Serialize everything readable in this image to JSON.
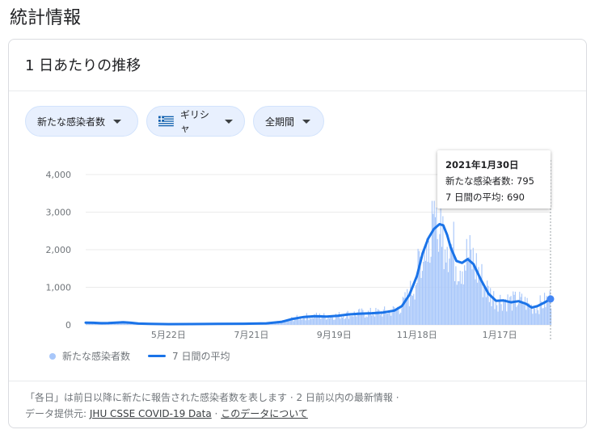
{
  "page_title": "統計情報",
  "card": {
    "title": "1 日あたりの推移",
    "filters": {
      "metric": "新たな感染者数",
      "country": "ギリシャ",
      "period": "全期間"
    }
  },
  "tooltip": {
    "date": "2021年1月30日",
    "cases_label": "新たな感染者数: 795",
    "avg_label": "7 日間の平均: 690"
  },
  "legend": {
    "bars": "新たな感染者数",
    "line": "7 日間の平均"
  },
  "footer": {
    "note": "「各日」は前日以降に新たに報告された感染者数を表します · 2 日前以内の最新情報 ·",
    "source_prefix": "データ提供元:",
    "source_link": "JHU CSSE COVID-19 Data",
    "separator": "·",
    "about_link": "このデータについて"
  },
  "colors": {
    "bars": "#a8c7fa",
    "line": "#1a73e8",
    "chip_bg": "#e8f0fe"
  },
  "chart_data": {
    "type": "bar",
    "title": "1 日あたりの推移",
    "series": [
      {
        "name": "新たな感染者数",
        "type": "bar"
      },
      {
        "name": "7 日間の平均",
        "type": "line"
      }
    ],
    "y_ticks": [
      "4,000",
      "3,000",
      "2,000",
      "1,000",
      "0"
    ],
    "ylim": [
      0,
      4000
    ],
    "x_ticks": [
      "5月22日",
      "7月21日",
      "9月19日",
      "11月18日",
      "1月17日"
    ],
    "grid": true,
    "legend_position": "bottom-left",
    "seven_day_avg": [
      [
        0,
        60
      ],
      [
        2,
        55
      ],
      [
        4,
        45
      ],
      [
        6,
        50
      ],
      [
        8,
        60
      ],
      [
        10,
        70
      ],
      [
        12,
        55
      ],
      [
        14,
        35
      ],
      [
        17,
        25
      ],
      [
        22,
        20
      ],
      [
        28,
        22
      ],
      [
        35,
        25
      ],
      [
        42,
        30
      ],
      [
        48,
        40
      ],
      [
        52,
        80
      ],
      [
        55,
        160
      ],
      [
        58,
        210
      ],
      [
        61,
        230
      ],
      [
        64,
        220
      ],
      [
        67,
        240
      ],
      [
        70,
        280
      ],
      [
        73,
        300
      ],
      [
        76,
        310
      ],
      [
        79,
        330
      ],
      [
        82,
        380
      ],
      [
        84,
        500
      ],
      [
        86,
        800
      ],
      [
        88,
        1300
      ],
      [
        89.5,
        1900
      ],
      [
        91,
        2300
      ],
      [
        92.5,
        2550
      ],
      [
        94,
        2680
      ],
      [
        95,
        2650
      ],
      [
        96,
        2400
      ],
      [
        97,
        2050
      ],
      [
        98.5,
        1700
      ],
      [
        100,
        1650
      ],
      [
        101.5,
        1750
      ],
      [
        103,
        1620
      ],
      [
        105,
        1200
      ],
      [
        107,
        830
      ],
      [
        109,
        640
      ],
      [
        111,
        650
      ],
      [
        113,
        600
      ],
      [
        115,
        630
      ],
      [
        117,
        560
      ],
      [
        118.5,
        460
      ],
      [
        120,
        500
      ],
      [
        122,
        600
      ],
      [
        123.5,
        690
      ]
    ],
    "daily_cases_sample": [
      [
        10,
        60
      ],
      [
        52,
        70
      ],
      [
        60,
        230
      ],
      [
        70,
        300
      ],
      [
        80,
        380
      ],
      [
        86,
        900
      ],
      [
        89,
        2000
      ],
      [
        92,
        3250
      ],
      [
        94,
        3100
      ],
      [
        96,
        1900
      ],
      [
        100,
        1500
      ],
      [
        104,
        1400
      ],
      [
        110,
        700
      ],
      [
        118,
        480
      ],
      [
        123.5,
        795
      ]
    ],
    "highlight": {
      "date": "2021年1月30日",
      "cases": 795,
      "avg": 690
    }
  }
}
